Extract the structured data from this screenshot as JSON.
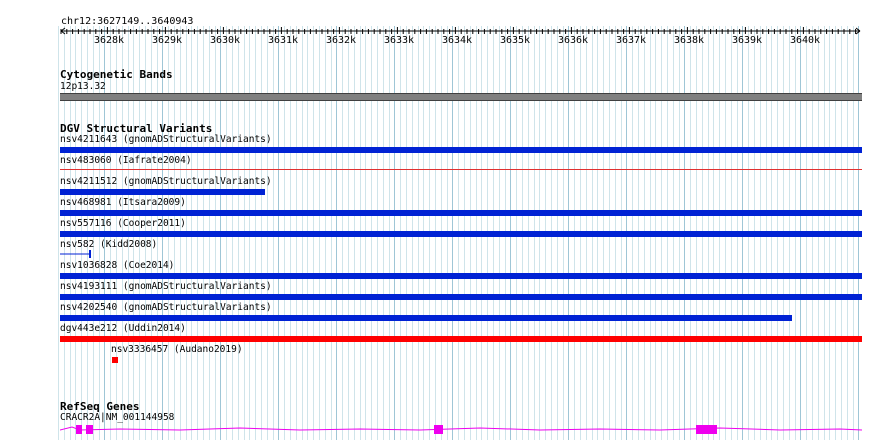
{
  "ruler": {
    "locus": "chr12:3627149..3640943",
    "ticks": [
      "3628k",
      "3629k",
      "3630k",
      "3631k",
      "3632k",
      "3633k",
      "3634k",
      "3635k",
      "3636k",
      "3637k",
      "3638k",
      "3639k",
      "3640k"
    ]
  },
  "cytoband": {
    "title": "Cytogenetic Bands",
    "band_label": "12p13.32"
  },
  "dgv": {
    "title": "DGV Structural Variants",
    "features": [
      {
        "label": "nsv4211643 (gnomADStructuralVariants)",
        "color": "#0022d4"
      },
      {
        "label": "nsv483060 (Iafrate2004)",
        "color": "#e03030"
      },
      {
        "label": "nsv4211512 (gnomADStructuralVariants)",
        "color": "#0022d4"
      },
      {
        "label": "nsv468981 (Itsara2009)",
        "color": "#0022d4"
      },
      {
        "label": "nsv557116 (Cooper2011)",
        "color": "#0022d4"
      },
      {
        "label": "nsv582 (Kidd2008)",
        "color": "#0022d4"
      },
      {
        "label": "nsv1036828 (Coe2014)",
        "color": "#0022d4"
      },
      {
        "label": "nsv4193111 (gnomADStructuralVariants)",
        "color": "#0022d4"
      },
      {
        "label": "nsv4202540 (gnomADStructuralVariants)",
        "color": "#0022d4"
      },
      {
        "label": "dgv443e212 (Uddin2014)",
        "color": "#ff0000"
      },
      {
        "label": "nsv3336457 (Audano2019)",
        "color": "#ff0000"
      }
    ]
  },
  "refseq": {
    "title": "RefSeq Genes",
    "gene_label": "CRACR2A|NM_001144958",
    "color": "#ee00ee"
  }
}
